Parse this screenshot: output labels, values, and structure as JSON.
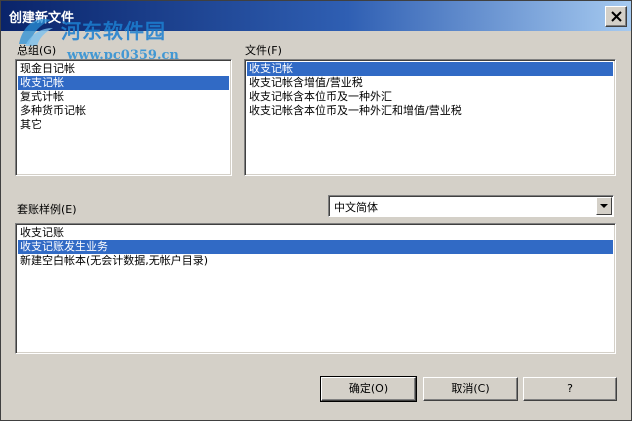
{
  "window": {
    "title": "创建新文件"
  },
  "watermark": {
    "name": "河东软件园",
    "url": "www.pc0359.cn"
  },
  "group": {
    "label": "总组(G)",
    "items": [
      "现金日记帐",
      "收支记帐",
      "复式计帐",
      "多种货币记帐",
      "其它"
    ],
    "selected_index": 1
  },
  "files": {
    "label": "文件(F)",
    "items": [
      "收支记帐",
      "收支记帐含增值/营业税",
      "收支记帐含本位币及一种外汇",
      "收支记帐含本位币及一种外汇和增值/营业税"
    ],
    "selected_index": 0
  },
  "sample": {
    "label": "套账样例(E)",
    "items": [
      "收支记账",
      "收支记账发生业务",
      "新建空白帐本(无会计数据,无帐户目录)"
    ],
    "selected_index": 1
  },
  "language": {
    "selected": "中文简体"
  },
  "buttons": {
    "ok": "确定(O)",
    "cancel": "取消(C)",
    "help": "?"
  },
  "icons": {
    "close": "close-icon",
    "dropdown": "chevron-down-icon"
  }
}
